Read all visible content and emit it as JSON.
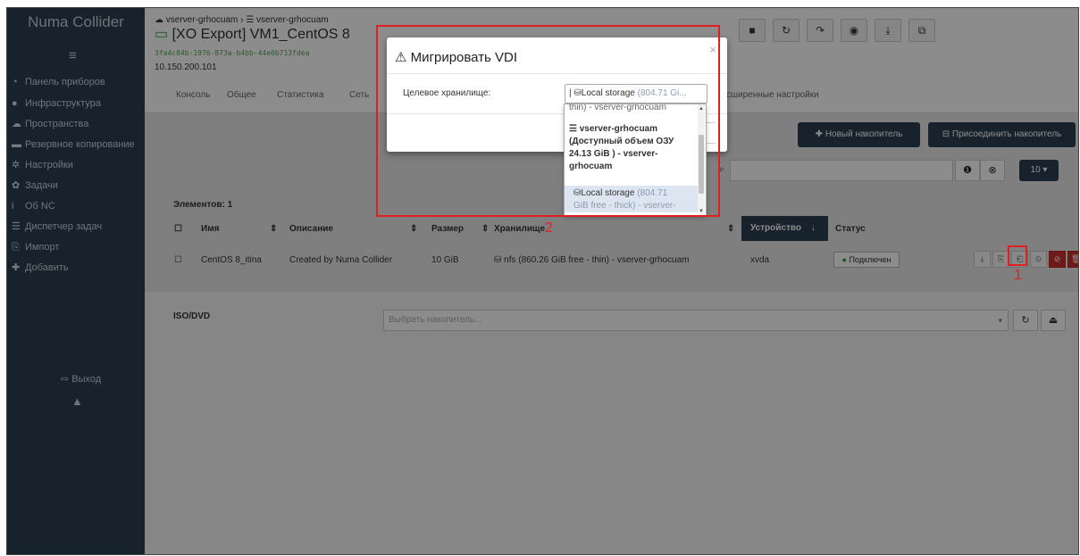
{
  "sidebar": {
    "brand": "Numa Collider",
    "burger_icon": "≡",
    "items": [
      {
        "icon": "tachometer-icon",
        "glyph": "◔",
        "label": "Панель приборов"
      },
      {
        "icon": "globe-icon",
        "glyph": "●",
        "label": "Инфраструктура"
      },
      {
        "icon": "cloud-icon",
        "glyph": "☁",
        "label": "Пространства"
      },
      {
        "icon": "archive-icon",
        "glyph": "▬",
        "label": "Резервное копирование"
      },
      {
        "icon": "gear-icon",
        "glyph": "✲",
        "label": "Настройки"
      },
      {
        "icon": "cogs-icon",
        "glyph": "✿",
        "label": "Задачи"
      },
      {
        "icon": "info-icon",
        "glyph": "i",
        "label": "Об NC"
      },
      {
        "icon": "tasks-icon",
        "glyph": "☰",
        "label": "Диспетчер задач"
      },
      {
        "icon": "import-icon",
        "glyph": "⎘",
        "label": "Импорт"
      },
      {
        "icon": "plus-icon",
        "glyph": "✚",
        "label": "Добавить"
      }
    ],
    "logout": "Выход",
    "logout_glyph": "⇨",
    "user_glyph": "▲"
  },
  "header": {
    "crumb_pool": "vserver-grhocuam",
    "crumb_host": "vserver-grhocuam",
    "title": "[XO Export] VM1_CentOS 8",
    "uuid": "3fa4c84b-1976-873a-b4bb-44e0b713fdea",
    "ip": "10.150.200.101",
    "tabs": [
      "Консоль",
      "Общее",
      "Статистика",
      "Сеть",
      "сширенные настройки"
    ],
    "action_glyphs": [
      "■",
      "↻",
      "↷",
      "◉",
      "⤓",
      "⧉"
    ]
  },
  "disks": {
    "new_disk_button": "Новый накопитель",
    "attach_disk_button": "Присоединить накопитель",
    "page_size": "10",
    "count_label": "Элементов: 1",
    "columns": {
      "name": "Имя",
      "description": "Описание",
      "size": "Размер",
      "storage": "Хранилище",
      "device": "Устройство",
      "status": "Статус"
    },
    "rows": [
      {
        "name": "CentOS 8_itina",
        "description": "Created by Numa Collider",
        "size": "10 GiB",
        "storage": "nfs (860.26 GiB free - thin) - vserver-grhocuam",
        "device": "xvda",
        "status": "Подключен"
      }
    ],
    "status_color": "#2b9a3f"
  },
  "iso": {
    "label": "ISO/DVD",
    "placeholder": "Выбрать накопитель..."
  },
  "modal": {
    "title": "Мигрировать VDI",
    "close": "×",
    "target_label": "Целевое хранилище:",
    "selected_name": "Local storage",
    "selected_detail": "(804.71 Gi...",
    "options": {
      "cut": "thin) - vserver-grhocuam",
      "host_line1": "vserver-grhocuam",
      "host_line2": "(Доступный объем ОЗУ",
      "host_line3": "24.13 GiB ) - vserver-",
      "host_line4": "grhocuam",
      "local_name": "Local storage",
      "local_detail1": "(804.71",
      "local_detail2": "GiB free - thick) - vserver-"
    }
  },
  "callouts": {
    "one": "1",
    "two": "2",
    "color": "#e02020"
  }
}
